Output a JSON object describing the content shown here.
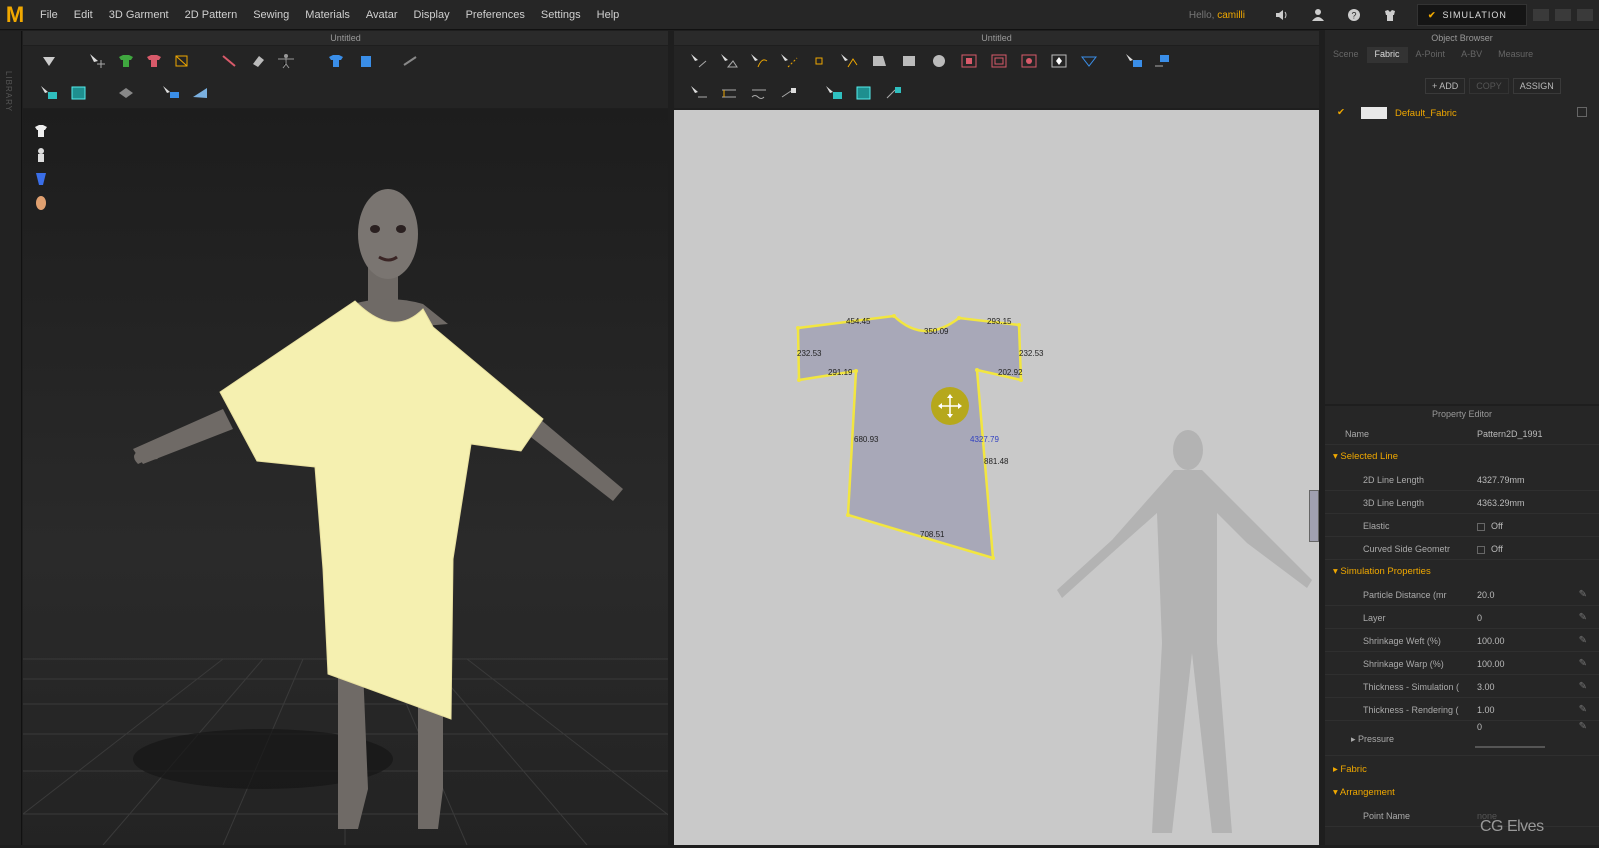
{
  "app": {
    "logo": "M"
  },
  "menu": [
    "File",
    "Edit",
    "3D Garment",
    "2D Pattern",
    "Sewing",
    "Materials",
    "Avatar",
    "Display",
    "Preferences",
    "Settings",
    "Help"
  ],
  "user": {
    "greeting": "Hello,",
    "name": "camilli"
  },
  "mode": {
    "label": "SIMULATION"
  },
  "library_tab": "LIBRARY",
  "left_window": {
    "title": "Untitled"
  },
  "right_window": {
    "title": "Untitled"
  },
  "pattern": {
    "measurements": [
      "454.45",
      "350.09",
      "293.15",
      "232.53",
      "232.53",
      "291.19",
      "202.92",
      "680.93",
      "4327.79",
      "881.48",
      "708.51"
    ]
  },
  "object_browser": {
    "title": "Object Browser",
    "tabs": [
      "Scene",
      "Fabric",
      "A-Point",
      "A-BV",
      "Measure"
    ],
    "active_tab": "Fabric",
    "actions": {
      "add": "ADD",
      "copy": "COPY",
      "assign": "ASSIGN"
    },
    "fabric_item": "Default_Fabric"
  },
  "property_editor": {
    "title": "Property Editor",
    "name_label": "Name",
    "name_value": "Pattern2D_1991",
    "sections": {
      "selected_line": "Selected Line",
      "simulation": "Simulation Properties",
      "fabric": "Fabric",
      "arrangement": "Arrangement"
    },
    "selected_line": [
      {
        "k": "2D Line Length",
        "v": "4327.79mm"
      },
      {
        "k": "3D Line Length",
        "v": "4363.29mm"
      },
      {
        "k": "Elastic",
        "v": "Off"
      },
      {
        "k": "Curved Side Geometr",
        "v": "Off"
      }
    ],
    "simulation": [
      {
        "k": "Particle Distance (mr",
        "v": "20.0"
      },
      {
        "k": "Layer",
        "v": "0"
      },
      {
        "k": "Shrinkage Weft (%)",
        "v": "100.00"
      },
      {
        "k": "Shrinkage Warp (%)",
        "v": "100.00"
      },
      {
        "k": "Thickness - Simulation (",
        "v": "3.00"
      },
      {
        "k": "Thickness - Rendering (",
        "v": "1.00"
      }
    ],
    "pressure": {
      "k": "Pressure",
      "v": "0"
    },
    "point_name": {
      "k": "Point Name",
      "v": "none"
    }
  },
  "watermark": "CG Elves",
  "colors": {
    "accent": "#f0a800",
    "garment": "#f5f0b0",
    "pattern_fill": "#a8a8b8",
    "pattern_edge": "#f2e640"
  }
}
